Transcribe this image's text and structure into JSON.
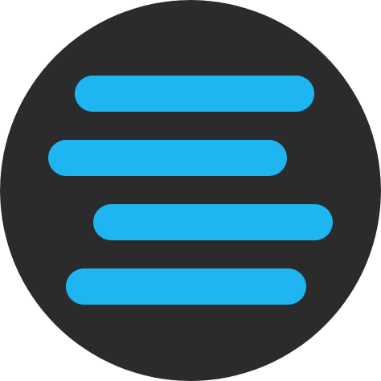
{
  "icon": {
    "name": "menu-lines-icon",
    "background_color": "#2b2b2b",
    "line_color": "#1eb6f2",
    "line_count": 4
  }
}
